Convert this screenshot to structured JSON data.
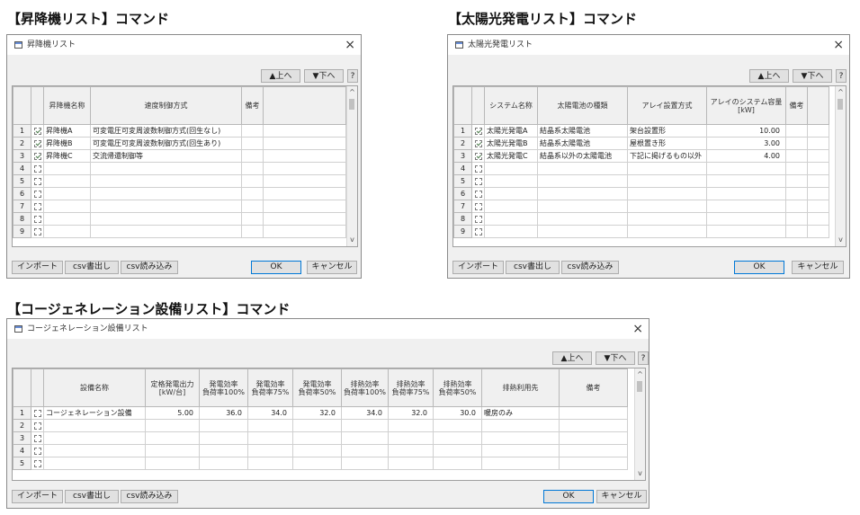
{
  "sections": {
    "elevator": "【昇降機リスト】コマンド",
    "solar": "【太陽光発電リスト】コマンド",
    "cogen": "【コージェネレーション設備リスト】コマンド"
  },
  "buttons": {
    "up": "▲上へ",
    "down": "▼下へ",
    "help": "?",
    "import": "インポート",
    "csv_export": "csv書出し",
    "csv_import": "csv読み込み",
    "ok": "OK",
    "cancel": "キャンセル",
    "close": "×"
  },
  "elevator": {
    "title": "昇降機リスト",
    "headers": [
      "昇降機名称",
      "速度制御方式",
      "備考"
    ],
    "rows": [
      {
        "no": "1",
        "checked": true,
        "name": "昇降機A",
        "control": "可変電圧可変周波数制御方式(回生なし)",
        "note": ""
      },
      {
        "no": "2",
        "checked": true,
        "name": "昇降機B",
        "control": "可変電圧可変周波数制御方式(回生あり)",
        "note": ""
      },
      {
        "no": "3",
        "checked": true,
        "name": "昇降機C",
        "control": "交流帰還制御等",
        "note": ""
      },
      {
        "no": "4",
        "checked": false,
        "name": "",
        "control": "",
        "note": ""
      },
      {
        "no": "5",
        "checked": false,
        "name": "",
        "control": "",
        "note": ""
      },
      {
        "no": "6",
        "checked": false,
        "name": "",
        "control": "",
        "note": ""
      },
      {
        "no": "7",
        "checked": false,
        "name": "",
        "control": "",
        "note": ""
      },
      {
        "no": "8",
        "checked": false,
        "name": "",
        "control": "",
        "note": ""
      },
      {
        "no": "9",
        "checked": false,
        "name": "",
        "control": "",
        "note": ""
      }
    ]
  },
  "solar": {
    "title": "太陽光発電リスト",
    "headers": [
      "システム名称",
      "太陽電池の種類",
      "アレイ設置方式",
      "アレイのシステム容量",
      "[kW]",
      "備考"
    ],
    "rows": [
      {
        "no": "1",
        "checked": true,
        "name": "太陽光発電A",
        "type": "結晶系太陽電池",
        "mount": "架台設置形",
        "capacity": "10.00",
        "note": ""
      },
      {
        "no": "2",
        "checked": true,
        "name": "太陽光発電B",
        "type": "結晶系太陽電池",
        "mount": "屋根置き形",
        "capacity": "3.00",
        "note": ""
      },
      {
        "no": "3",
        "checked": true,
        "name": "太陽光発電C",
        "type": "結晶系以外の太陽電池",
        "mount": "下記に掲げるもの以外",
        "capacity": "4.00",
        "note": ""
      },
      {
        "no": "4",
        "checked": false,
        "name": "",
        "type": "",
        "mount": "",
        "capacity": "",
        "note": ""
      },
      {
        "no": "5",
        "checked": false,
        "name": "",
        "type": "",
        "mount": "",
        "capacity": "",
        "note": ""
      },
      {
        "no": "6",
        "checked": false,
        "name": "",
        "type": "",
        "mount": "",
        "capacity": "",
        "note": ""
      },
      {
        "no": "7",
        "checked": false,
        "name": "",
        "type": "",
        "mount": "",
        "capacity": "",
        "note": ""
      },
      {
        "no": "8",
        "checked": false,
        "name": "",
        "type": "",
        "mount": "",
        "capacity": "",
        "note": ""
      },
      {
        "no": "9",
        "checked": false,
        "name": "",
        "type": "",
        "mount": "",
        "capacity": "",
        "note": ""
      }
    ]
  },
  "cogen": {
    "title": "コージェネレーション設備リスト",
    "headers": [
      {
        "l1": "設備名称",
        "l2": ""
      },
      {
        "l1": "定格発電出力",
        "l2": "[kW/台]"
      },
      {
        "l1": "発電効率",
        "l2": "負荷率100%"
      },
      {
        "l1": "発電効率",
        "l2": "負荷率75%"
      },
      {
        "l1": "発電効率",
        "l2": "負荷率50%"
      },
      {
        "l1": "排熱効率",
        "l2": "負荷率100%"
      },
      {
        "l1": "排熱効率",
        "l2": "負荷率75%"
      },
      {
        "l1": "排熱効率",
        "l2": "負荷率50%"
      },
      {
        "l1": "排熱利用先",
        "l2": ""
      },
      {
        "l1": "備考",
        "l2": ""
      }
    ],
    "rows": [
      {
        "no": "1",
        "checked": false,
        "cells": [
          "コージェネレーション設備",
          "5.00",
          "36.0",
          "34.0",
          "32.0",
          "34.0",
          "32.0",
          "30.0",
          "暖房のみ",
          ""
        ]
      },
      {
        "no": "2",
        "checked": false,
        "cells": [
          "",
          "",
          "",
          "",
          "",
          "",
          "",
          "",
          "",
          ""
        ]
      },
      {
        "no": "3",
        "checked": false,
        "cells": [
          "",
          "",
          "",
          "",
          "",
          "",
          "",
          "",
          "",
          ""
        ]
      },
      {
        "no": "4",
        "checked": false,
        "cells": [
          "",
          "",
          "",
          "",
          "",
          "",
          "",
          "",
          "",
          ""
        ]
      },
      {
        "no": "5",
        "checked": false,
        "cells": [
          "",
          "",
          "",
          "",
          "",
          "",
          "",
          "",
          "",
          ""
        ]
      }
    ]
  }
}
